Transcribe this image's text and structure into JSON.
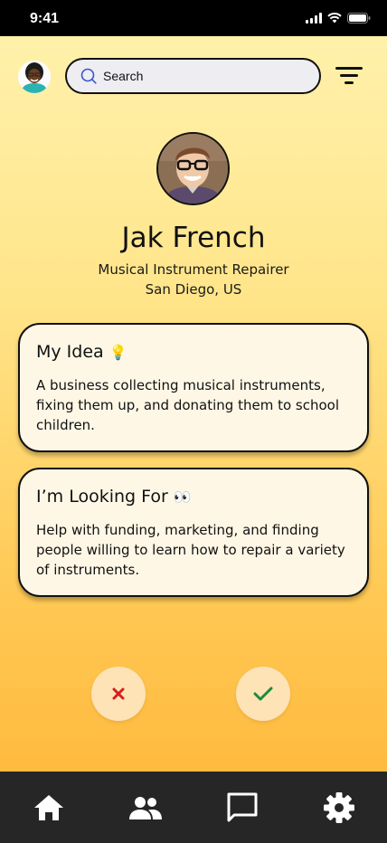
{
  "status_bar": {
    "time": "9:41"
  },
  "search": {
    "placeholder": "Search"
  },
  "profile": {
    "name": "Jak French",
    "role": "Musical Instrument Repairer",
    "location": "San Diego, US"
  },
  "cards": {
    "idea": {
      "title": "My Idea",
      "emoji": "💡",
      "body": "A business collecting musical instruments, fixing them up, and donating them to school children."
    },
    "looking_for": {
      "title": "I’m Looking For",
      "emoji": "👀",
      "body": "Help with funding, marketing, and finding people willing to learn how to repair a variety of instruments."
    }
  },
  "actions": {
    "reject_icon": "x-icon",
    "accept_icon": "checkmark-icon"
  },
  "tabs": [
    {
      "icon": "home-icon"
    },
    {
      "icon": "people-icon"
    },
    {
      "icon": "chat-icon"
    },
    {
      "icon": "gear-icon"
    }
  ],
  "colors": {
    "reject": "#d61f1f",
    "accept": "#1d8a3f",
    "tab_bar": "#262626",
    "card": "#fff7e6"
  }
}
